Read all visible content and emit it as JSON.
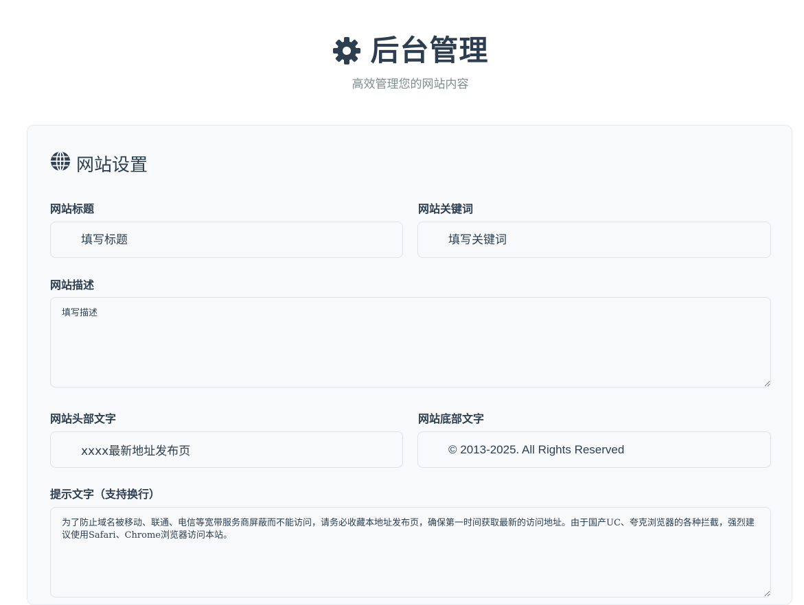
{
  "header": {
    "title": "后台管理",
    "subtitle": "高效管理您的网站内容",
    "icon": "gear-icon"
  },
  "settings": {
    "section_title": "网站设置",
    "section_icon": "globe-icon",
    "site_title": {
      "label": "网站标题",
      "placeholder": "填写标题",
      "value": ""
    },
    "keywords": {
      "label": "网站关键词",
      "placeholder": "填写关键词",
      "value": ""
    },
    "description": {
      "label": "网站描述",
      "placeholder": "填写描述",
      "value": ""
    },
    "header_text": {
      "label": "网站头部文字",
      "placeholder": "",
      "value": "xxxx最新地址发布页"
    },
    "footer_text": {
      "label": "网站底部文字",
      "placeholder": "",
      "value": "© 2013-2025. All Rights Reserved"
    },
    "notice": {
      "label": "提示文字（支持换行）",
      "value": "为了防止域名被移动、联通、电信等宽带服务商屏蔽而不能访问，请务必收藏本地址发布页，确保第一时间获取最新的访问地址。由于国产UC、夸克浏览器的各种拦截，强烈建议使用Safari、Chrome浏览器访问本站。"
    }
  },
  "colors": {
    "text": "#2c3e50",
    "muted": "#7f8c8d",
    "card_bg": "#f8f9fa",
    "border": "#dfe3e8"
  }
}
